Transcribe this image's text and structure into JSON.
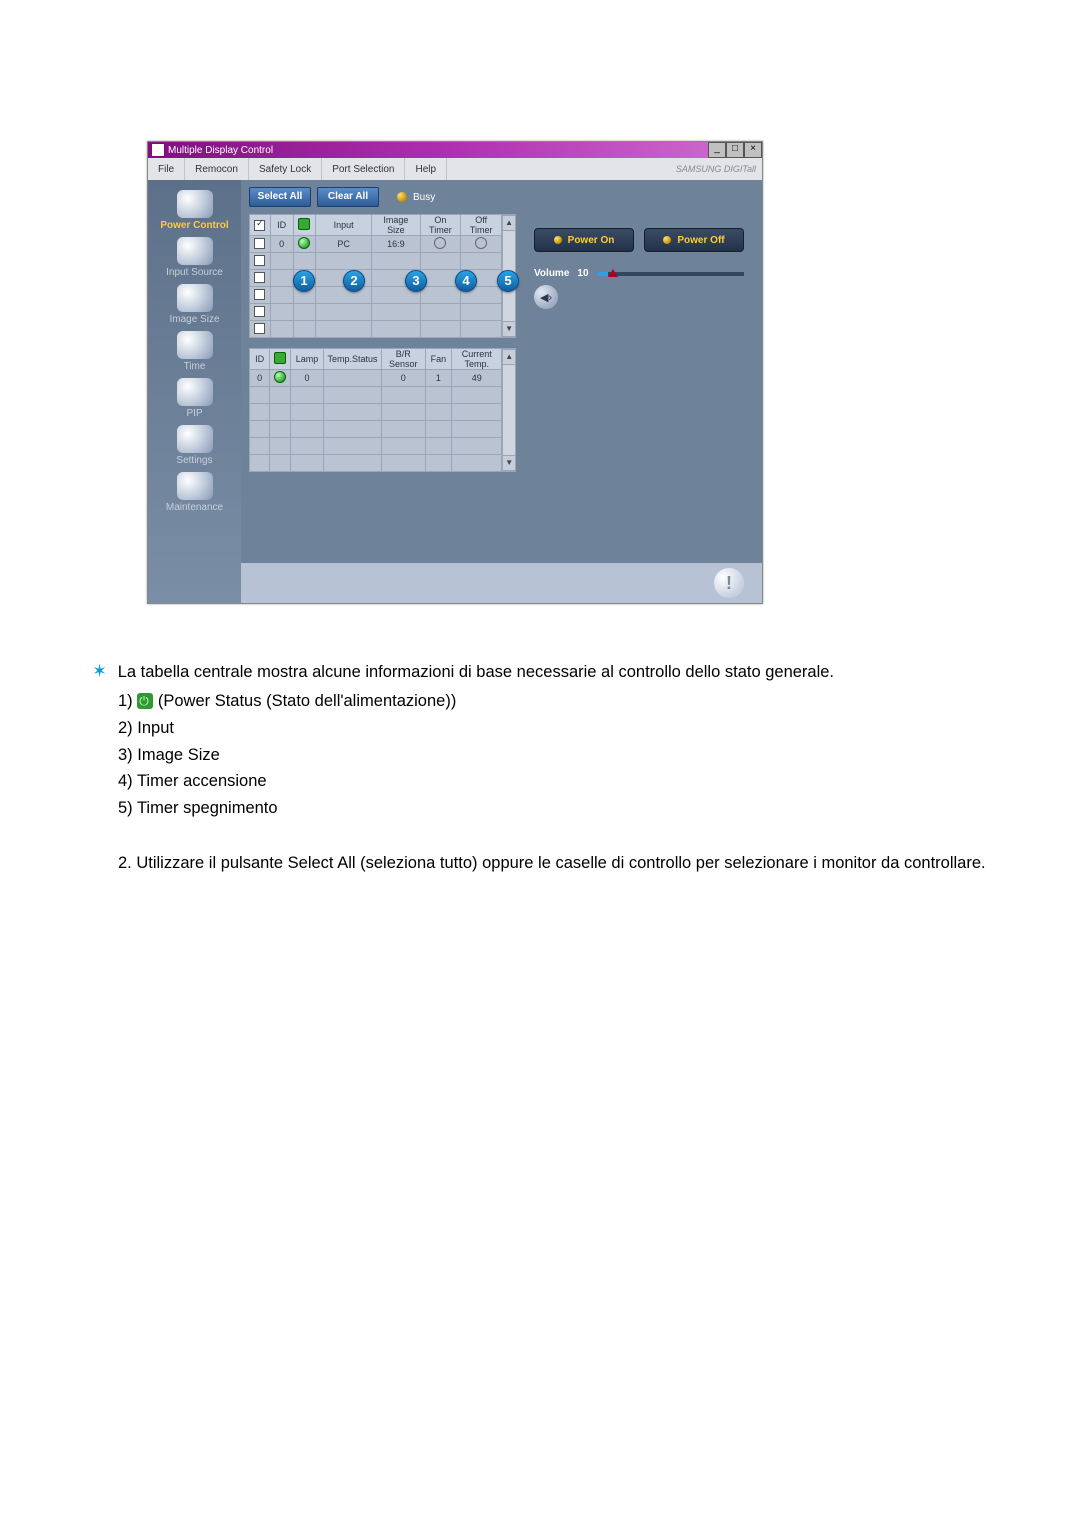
{
  "window": {
    "title": "Multiple Display Control",
    "minimize": "_",
    "maximize": "□",
    "close": "×"
  },
  "menubar": {
    "file": "File",
    "remocon": "Remocon",
    "safety_lock": "Safety Lock",
    "port_selection": "Port Selection",
    "help": "Help",
    "brand": "SAMSUNG DIGITall"
  },
  "sidebar": {
    "items": [
      {
        "label": "Power Control"
      },
      {
        "label": "Input Source"
      },
      {
        "label": "Image Size"
      },
      {
        "label": "Time"
      },
      {
        "label": "PIP"
      },
      {
        "label": "Settings"
      },
      {
        "label": "Maintenance"
      }
    ]
  },
  "toolbar": {
    "select_all": "Select All",
    "clear_all": "Clear All",
    "busy": "Busy"
  },
  "table1": {
    "headers": {
      "chk": "",
      "id": "ID",
      "pwr": "",
      "input": "Input",
      "image_size": "Image Size",
      "on_timer": "On Timer",
      "off_timer": "Off Timer"
    },
    "rows": [
      {
        "chk": false,
        "id": "0",
        "pwr": "on",
        "input": "PC",
        "image_size": "16:9",
        "on_timer": "○",
        "off_timer": "○"
      },
      {
        "chk": false,
        "id": "",
        "pwr": "",
        "input": "",
        "image_size": "",
        "on_timer": "",
        "off_timer": ""
      },
      {
        "chk": false,
        "id": "",
        "pwr": "",
        "input": "",
        "image_size": "",
        "on_timer": "",
        "off_timer": ""
      },
      {
        "chk": false,
        "id": "",
        "pwr": "",
        "input": "",
        "image_size": "",
        "on_timer": "",
        "off_timer": ""
      },
      {
        "chk": false,
        "id": "",
        "pwr": "",
        "input": "",
        "image_size": "",
        "on_timer": "",
        "off_timer": ""
      },
      {
        "chk": false,
        "id": "",
        "pwr": "",
        "input": "",
        "image_size": "",
        "on_timer": "",
        "off_timer": ""
      }
    ],
    "callouts": [
      "1",
      "2",
      "3",
      "4",
      "5"
    ]
  },
  "table2": {
    "headers": {
      "id": "ID",
      "pwr": "",
      "lamp": "Lamp",
      "temp_status": "Temp.Status",
      "br_sensor": "B/R Sensor",
      "fan": "Fan",
      "current_temp": "Current Temp."
    },
    "rows": [
      {
        "id": "0",
        "pwr": "on",
        "lamp": "0",
        "temp_status": "",
        "br_sensor": "0",
        "fan": "1",
        "current_temp": "49"
      },
      {
        "id": "",
        "pwr": "",
        "lamp": "",
        "temp_status": "",
        "br_sensor": "",
        "fan": "",
        "current_temp": ""
      },
      {
        "id": "",
        "pwr": "",
        "lamp": "",
        "temp_status": "",
        "br_sensor": "",
        "fan": "",
        "current_temp": ""
      },
      {
        "id": "",
        "pwr": "",
        "lamp": "",
        "temp_status": "",
        "br_sensor": "",
        "fan": "",
        "current_temp": ""
      },
      {
        "id": "",
        "pwr": "",
        "lamp": "",
        "temp_status": "",
        "br_sensor": "",
        "fan": "",
        "current_temp": ""
      },
      {
        "id": "",
        "pwr": "",
        "lamp": "",
        "temp_status": "",
        "br_sensor": "",
        "fan": "",
        "current_temp": ""
      }
    ]
  },
  "rightpanel": {
    "power_on": "Power On",
    "power_off": "Power Off",
    "volume_label": "Volume",
    "volume_value": "10",
    "volume_icon": "◀›"
  },
  "statusbar": {
    "warn": "!"
  },
  "doc": {
    "intro": "La tabella centrale mostra alcune informazioni di base necessarie al controllo dello stato generale.",
    "items": {
      "i1_prefix": "1) ",
      "i1_text": " (Power Status (Stato dell'alimentazione))",
      "i2": "2) Input",
      "i3": "3) Image Size",
      "i4": "4) Timer accensione",
      "i5": "5) Timer spegnimento"
    },
    "p2": "2.  Utilizzare il pulsante Select All (seleziona tutto) oppure le caselle di controllo per selezionare i monitor da controllare."
  }
}
